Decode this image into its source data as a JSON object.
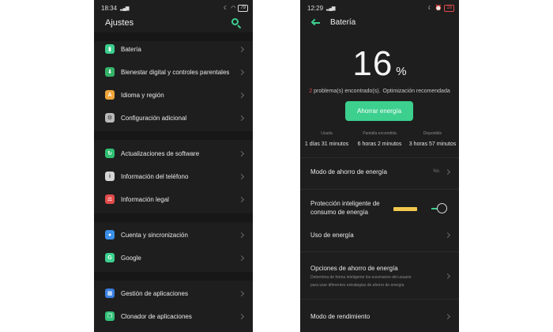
{
  "left": {
    "status": {
      "time": "18:34",
      "battery": "79"
    },
    "title": "Ajustes",
    "items": [
      {
        "label": "Batería",
        "color": "#3ccf8e",
        "glyph": "▮"
      },
      {
        "label": "Bienestar digital y controles parentales",
        "color": "#34b36a",
        "glyph": "⬇"
      },
      {
        "label": "Idioma y región",
        "color": "#f0a53a",
        "glyph": "A"
      },
      {
        "label": "Configuración adicional",
        "color": "#b9b9b9",
        "glyph": "⚙"
      },
      {
        "label": "Actualizaciones de software",
        "color": "#2fbf71",
        "glyph": "↻"
      },
      {
        "label": "Información del teléfono",
        "color": "#d6d6d6",
        "glyph": "i"
      },
      {
        "label": "Información legal",
        "color": "#e24a4a",
        "glyph": "⚖"
      },
      {
        "label": "Cuenta y sincronización",
        "color": "#3a8fe8",
        "glyph": "👤"
      },
      {
        "label": "Google",
        "color": "#3ccf8e",
        "glyph": "G"
      },
      {
        "label": "Gestión de aplicaciones",
        "color": "#3a7fe0",
        "glyph": "▦"
      },
      {
        "label": "Clonador de aplicaciones",
        "color": "#33c07a",
        "glyph": "❐"
      }
    ]
  },
  "right": {
    "status": {
      "time": "12:29",
      "battery": "16"
    },
    "title": "Batería",
    "percent": "16",
    "percent_unit": "%",
    "problems": {
      "count": "2",
      "text": "problema(s) encontrado(s).",
      "link": "Optimización recomendada"
    },
    "save_button": "Ahorrar energía",
    "stats": [
      {
        "caption": "Usada",
        "value": "1 días 31 minutos"
      },
      {
        "caption": "Pantalla encendida",
        "value": "6 horas 2 minutos"
      },
      {
        "caption": "Disponible",
        "value": "3 horas 57 minutos"
      }
    ],
    "saver_mode": {
      "label": "Modo de ahorro de energía",
      "value": "No"
    },
    "smart_protection": {
      "label_line1": "Protección inteligente de",
      "label_line2": "consumo de energía"
    },
    "energy_use": "Uso de energía",
    "saver_options": {
      "label": "Opciones de ahorro de energía",
      "desc_line1": "Determina de forma inteligente los escenarios del usuario",
      "desc_line2": "para usar diferentes estrategias de ahorro de energía"
    },
    "performance_mode": "Modo de rendimiento"
  }
}
